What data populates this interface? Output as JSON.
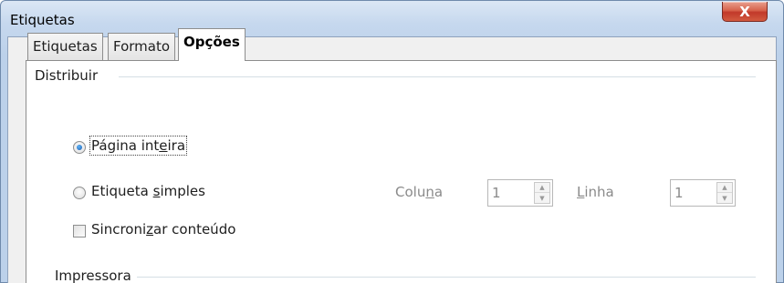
{
  "window": {
    "title": "Etiquetas",
    "close_glyph": "X"
  },
  "tabs": [
    {
      "label": "Etiquetas",
      "active": false
    },
    {
      "label": "Formato",
      "active": false
    },
    {
      "label": "Opções",
      "active": true
    }
  ],
  "distribuir": {
    "title": "Distribuir",
    "full_page": {
      "label_pre": "Página int",
      "label_u": "e",
      "label_post": "ira",
      "checked": true
    },
    "single_label": {
      "label_pre": "Etiqueta ",
      "label_u": "s",
      "label_post": "imples",
      "checked": false
    },
    "column": {
      "label_pre": "Colu",
      "label_u": "n",
      "label_post": "a",
      "value": "1"
    },
    "row": {
      "label_pre": "",
      "label_u": "L",
      "label_post": "inha",
      "value": "1"
    },
    "sync": {
      "label_pre": "Sincroni",
      "label_u": "z",
      "label_post": "ar conteúdo",
      "checked": false
    }
  },
  "impressora": {
    "title": "Impressora"
  },
  "icons": {
    "spin_up": "▲",
    "spin_down": "▼"
  }
}
